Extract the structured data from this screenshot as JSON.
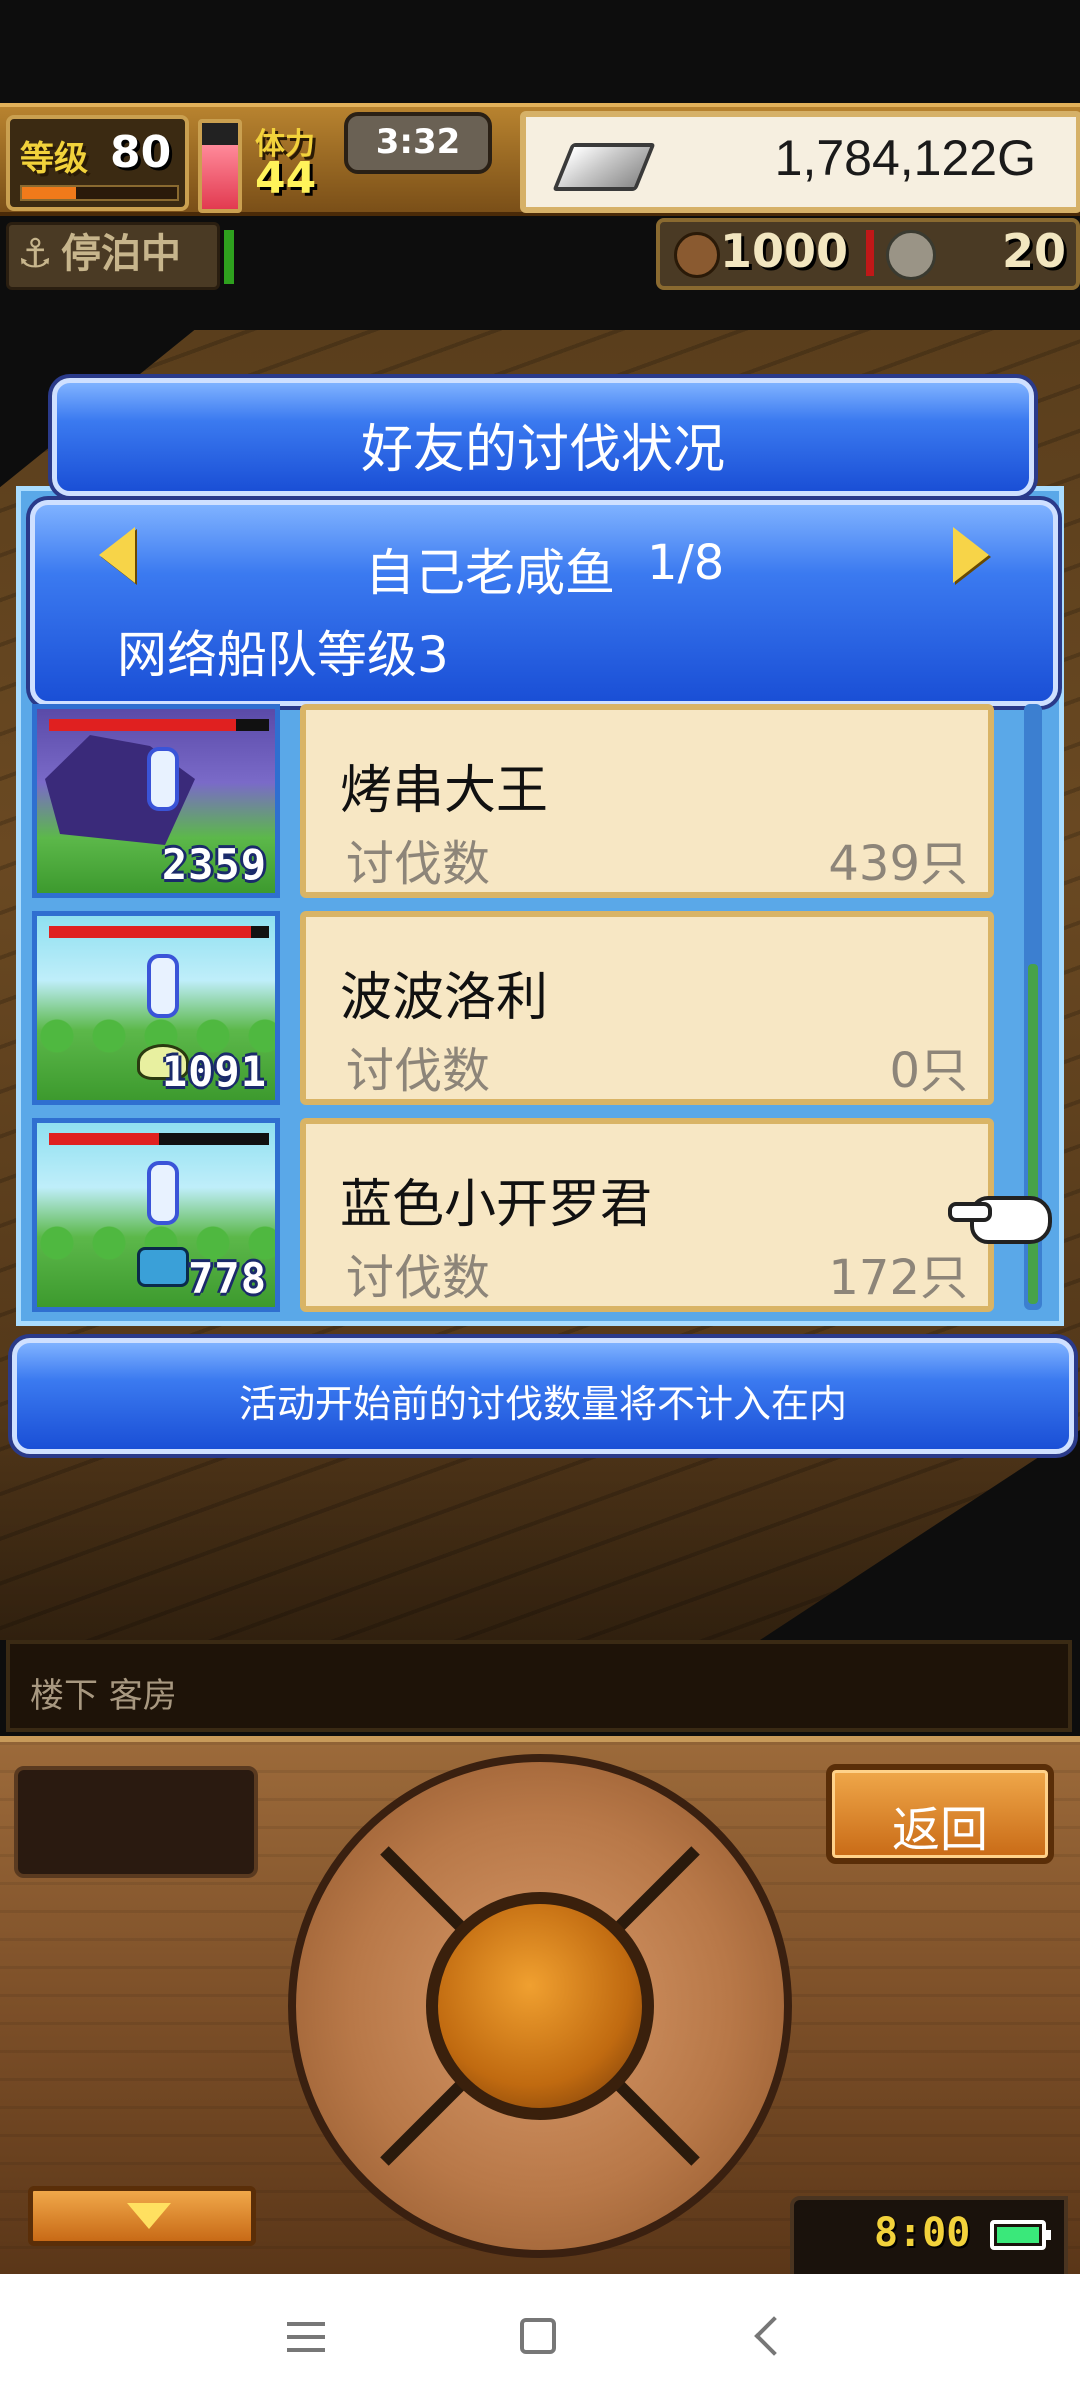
{
  "status": {
    "level_label": "等级",
    "level_value": "80",
    "level_progress": 0.35,
    "stamina_label": "体力",
    "stamina_value": "44",
    "stamina_gauge": 0.75,
    "clock": "3:32",
    "gold": "1,784,122G",
    "moored_label": "停泊中",
    "resource1": "1000",
    "resource2": "20"
  },
  "dialog": {
    "title": "好友的讨伐状况",
    "user_name": "自己老咸鱼",
    "user_page": "1/8",
    "fleet_level": "网络船队等级3",
    "notice": "活动开始前的讨伐数量将不计入在内",
    "rows": [
      {
        "name": "烤串大王",
        "stat_label": "讨伐数",
        "stat_value": "439只",
        "power": "2359",
        "hp_fraction": 0.85
      },
      {
        "name": "波波洛利",
        "stat_label": "讨伐数",
        "stat_value": "0只",
        "power": "1091",
        "hp_fraction": 0.92
      },
      {
        "name": "蓝色小开罗君",
        "stat_label": "讨伐数",
        "stat_value": "172只",
        "power": "778",
        "hp_fraction": 0.5
      }
    ]
  },
  "location": "楼下 客房",
  "controls": {
    "back_label": "返回",
    "time": "8:00"
  },
  "icons": {
    "anchor": "anchor-icon",
    "ingot": "silver-ingot-icon",
    "bag": "bag-icon",
    "coin": "coin-icon",
    "battery": "battery-icon"
  }
}
